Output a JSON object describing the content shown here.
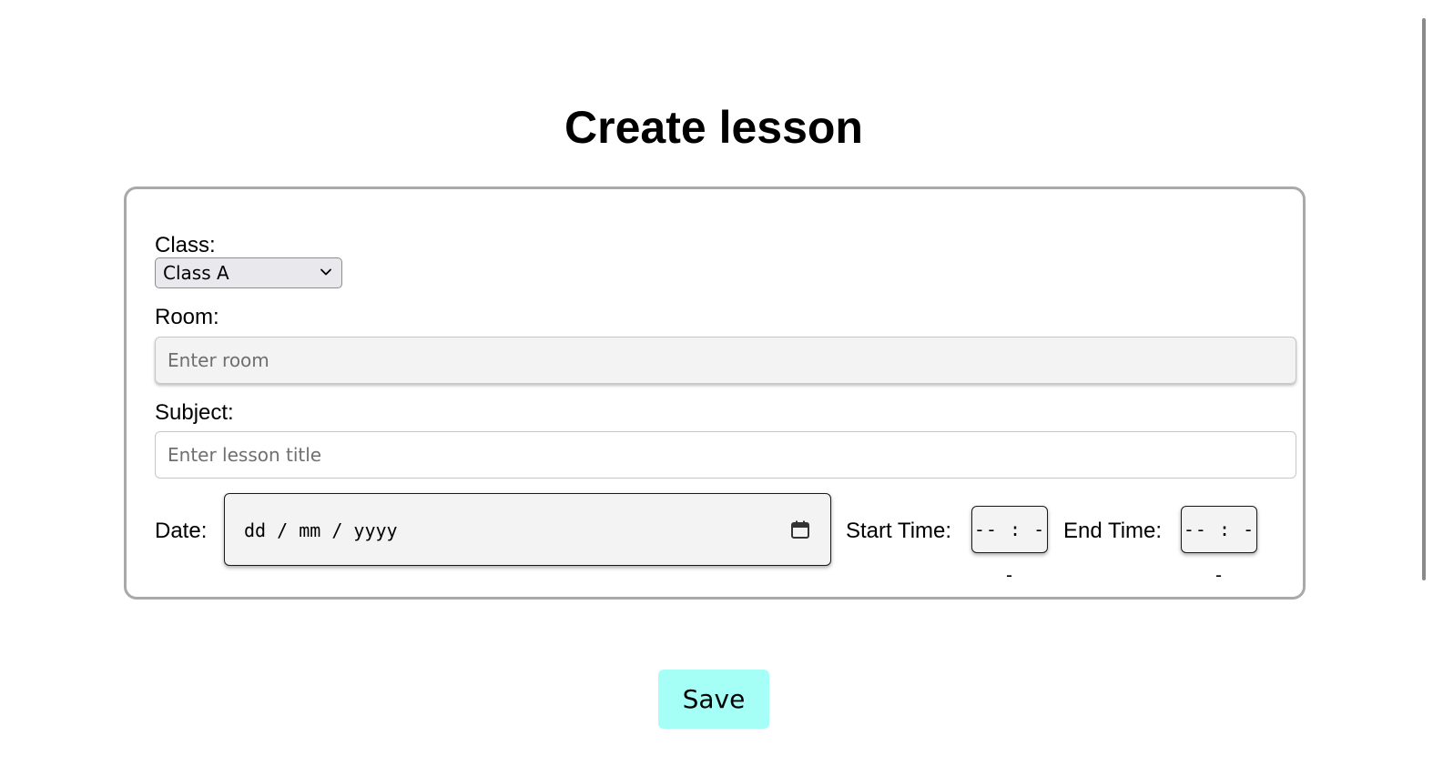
{
  "page": {
    "title": "Create lesson"
  },
  "form": {
    "class": {
      "label": "Class:",
      "selected": "Class A"
    },
    "room": {
      "label": "Room:",
      "placeholder": "Enter room"
    },
    "subject": {
      "label": "Subject:",
      "placeholder": "Enter lesson title"
    },
    "date": {
      "label": "Date:",
      "placeholder": "dd / mm / yyyy",
      "icon": "calendar-icon"
    },
    "start_time": {
      "label": "Start Time:",
      "placeholder": "-- : --"
    },
    "end_time": {
      "label": "End Time:",
      "placeholder": "-- : --"
    }
  },
  "actions": {
    "save_label": "Save"
  },
  "colors": {
    "save_button_bg": "#a6fff6",
    "card_border": "#a9a9a9"
  }
}
